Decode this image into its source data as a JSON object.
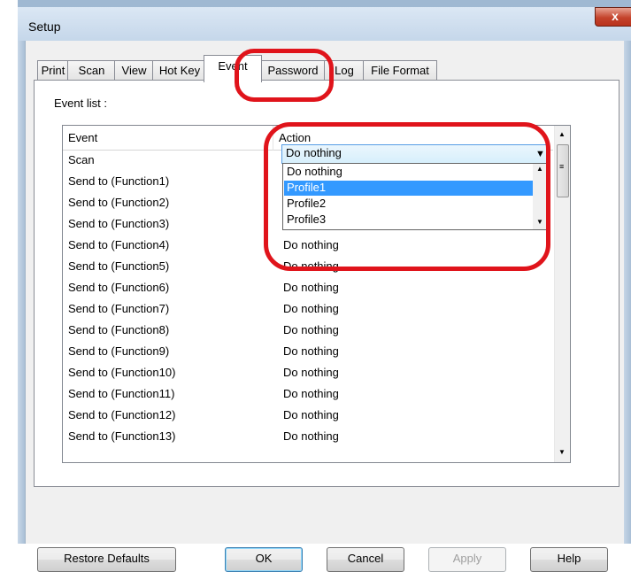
{
  "window": {
    "title": "Setup",
    "close_glyph": "x"
  },
  "tabs": [
    "Print",
    "Scan",
    "View",
    "Hot Key",
    "Event",
    "Password",
    "Log",
    "File Format"
  ],
  "active_tab": "Event",
  "event_list_label": "Event list :",
  "columns": {
    "event": "Event",
    "action": "Action"
  },
  "rows": [
    {
      "event": "Scan",
      "action": "Do nothing"
    },
    {
      "event": "Send to (Function1)",
      "action": ""
    },
    {
      "event": "Send to (Function2)",
      "action": ""
    },
    {
      "event": "Send to (Function3)",
      "action": ""
    },
    {
      "event": "Send to (Function4)",
      "action": "Do nothing"
    },
    {
      "event": "Send to (Function5)",
      "action": "Do nothing"
    },
    {
      "event": "Send to (Function6)",
      "action": "Do nothing"
    },
    {
      "event": "Send to (Function7)",
      "action": "Do nothing"
    },
    {
      "event": "Send to (Function8)",
      "action": "Do nothing"
    },
    {
      "event": "Send to (Function9)",
      "action": "Do nothing"
    },
    {
      "event": "Send to (Function10)",
      "action": "Do nothing"
    },
    {
      "event": "Send to (Function11)",
      "action": "Do nothing"
    },
    {
      "event": "Send to (Function12)",
      "action": "Do nothing"
    },
    {
      "event": "Send to (Function13)",
      "action": "Do nothing"
    }
  ],
  "dropdown": {
    "value": "Do nothing",
    "options": [
      "Do nothing",
      "Profile1",
      "Profile2",
      "Profile3"
    ],
    "selected_option": "Profile1"
  },
  "buttons": {
    "restore": "Restore Defaults",
    "ok": "OK",
    "cancel": "Cancel",
    "apply": "Apply",
    "help": "Help"
  },
  "colors": {
    "highlight_red": "#e0141b",
    "selection_blue": "#3399ff",
    "close_red": "#c4432c"
  }
}
